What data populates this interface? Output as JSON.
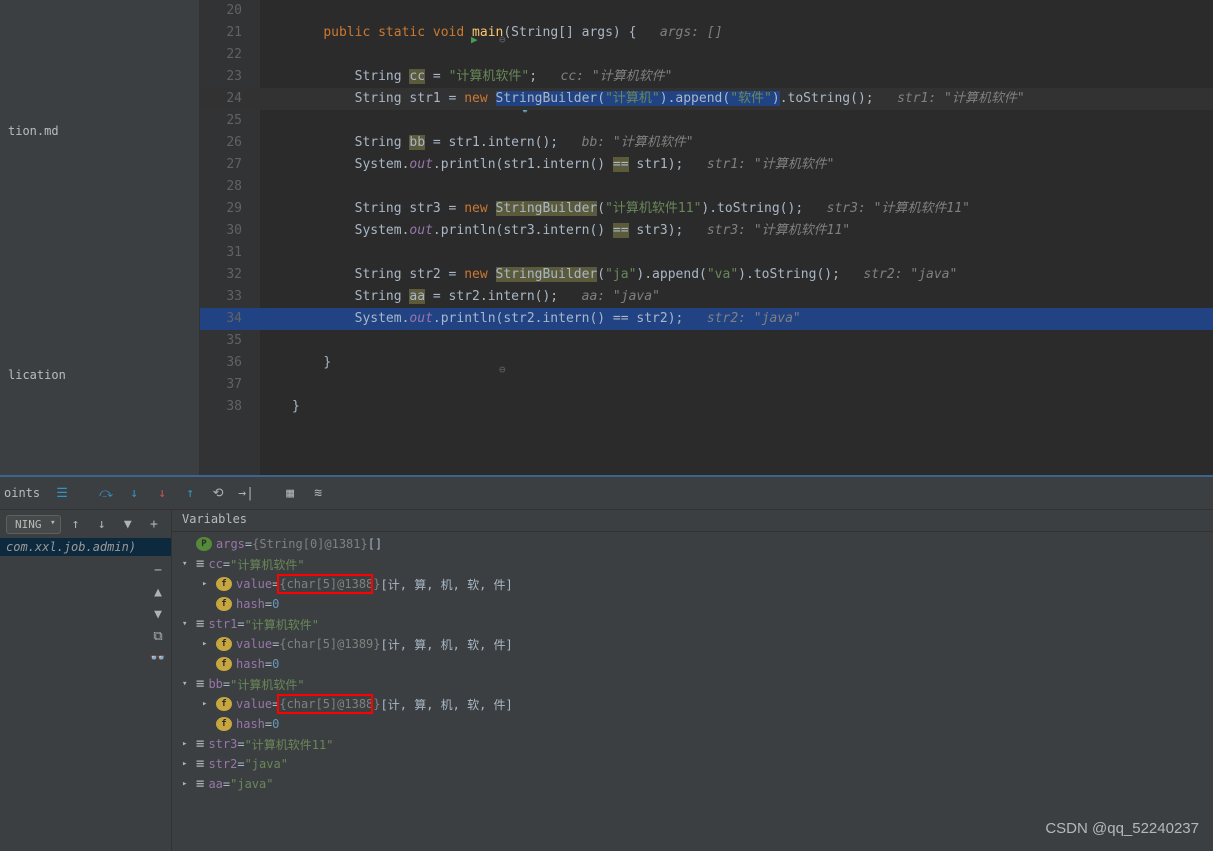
{
  "sidebar": {
    "item1": "tion.md",
    "item2": "lication"
  },
  "gutter": {
    "start": 20,
    "end": 38
  },
  "code": {
    "lines": [
      {
        "indent": 1,
        "tokens": []
      },
      {
        "indent": 1,
        "tokens": [
          {
            "t": "kw",
            "v": "public"
          },
          {
            "t": "sp"
          },
          {
            "t": "kw",
            "v": "static"
          },
          {
            "t": "sp"
          },
          {
            "t": "kw",
            "v": "void"
          },
          {
            "t": "sp"
          },
          {
            "t": "method",
            "v": "main"
          },
          {
            "t": "p",
            "v": "(String[] args) {"
          },
          {
            "t": "sp3"
          },
          {
            "t": "comment",
            "v": "args: []"
          }
        ]
      },
      {
        "indent": 1,
        "tokens": []
      },
      {
        "indent": 2,
        "tokens": [
          {
            "t": "p",
            "v": "String "
          },
          {
            "t": "hl",
            "v": "cc"
          },
          {
            "t": "p",
            "v": " = "
          },
          {
            "t": "str",
            "v": "\"计算机软件\""
          },
          {
            "t": "p",
            "v": ";"
          },
          {
            "t": "sp3"
          },
          {
            "t": "comment",
            "v": "cc: \"计算机软件\""
          }
        ]
      },
      {
        "indent": 2,
        "hl": "sel",
        "tokens": [
          {
            "t": "p",
            "v": "String str1 = "
          },
          {
            "t": "kw",
            "v": "new"
          },
          {
            "t": "sp"
          },
          {
            "t": "selbg",
            "v": "StringBuilder("
          },
          {
            "t": "selbg-str",
            "v": "\"计算机\""
          },
          {
            "t": "selbg",
            "v": ").append("
          },
          {
            "t": "selbg-str",
            "v": "\"软件\""
          },
          {
            "t": "selbg",
            "v": ")"
          },
          {
            "t": "p",
            "v": ".toString();"
          },
          {
            "t": "sp3"
          },
          {
            "t": "comment",
            "v": "str1: \"计算机软件\""
          }
        ]
      },
      {
        "indent": 2,
        "tokens": []
      },
      {
        "indent": 2,
        "tokens": [
          {
            "t": "p",
            "v": "String "
          },
          {
            "t": "hl",
            "v": "bb"
          },
          {
            "t": "p",
            "v": " = str1.intern();"
          },
          {
            "t": "sp3"
          },
          {
            "t": "comment",
            "v": "bb: \"计算机软件\""
          }
        ]
      },
      {
        "indent": 2,
        "tokens": [
          {
            "t": "p",
            "v": "System."
          },
          {
            "t": "field",
            "v": "out"
          },
          {
            "t": "p",
            "v": ".println(str1.intern() "
          },
          {
            "t": "hl",
            "v": "=="
          },
          {
            "t": "p",
            "v": " str1);"
          },
          {
            "t": "sp3"
          },
          {
            "t": "comment",
            "v": "str1: \"计算机软件\""
          }
        ]
      },
      {
        "indent": 2,
        "tokens": []
      },
      {
        "indent": 2,
        "tokens": [
          {
            "t": "p",
            "v": "String str3 = "
          },
          {
            "t": "kw",
            "v": "new"
          },
          {
            "t": "sp"
          },
          {
            "t": "hl",
            "v": "StringBuilder"
          },
          {
            "t": "p",
            "v": "("
          },
          {
            "t": "str",
            "v": "\"计算机软件11\""
          },
          {
            "t": "p",
            "v": ").toString();"
          },
          {
            "t": "sp3"
          },
          {
            "t": "comment",
            "v": "str3: \"计算机软件11\""
          }
        ]
      },
      {
        "indent": 2,
        "tokens": [
          {
            "t": "p",
            "v": "System."
          },
          {
            "t": "field",
            "v": "out"
          },
          {
            "t": "p",
            "v": ".println(str3.intern() "
          },
          {
            "t": "hl",
            "v": "=="
          },
          {
            "t": "p",
            "v": " str3);"
          },
          {
            "t": "sp3"
          },
          {
            "t": "comment",
            "v": "str3: \"计算机软件11\""
          }
        ]
      },
      {
        "indent": 2,
        "tokens": []
      },
      {
        "indent": 2,
        "tokens": [
          {
            "t": "p",
            "v": "String str2 = "
          },
          {
            "t": "kw",
            "v": "new"
          },
          {
            "t": "sp"
          },
          {
            "t": "hl",
            "v": "StringBuilder"
          },
          {
            "t": "p",
            "v": "("
          },
          {
            "t": "str",
            "v": "\"ja\""
          },
          {
            "t": "p",
            "v": ").append("
          },
          {
            "t": "str",
            "v": "\"va\""
          },
          {
            "t": "p",
            "v": ").toString();"
          },
          {
            "t": "sp3"
          },
          {
            "t": "comment",
            "v": "str2: \"java\""
          }
        ]
      },
      {
        "indent": 2,
        "tokens": [
          {
            "t": "p",
            "v": "String "
          },
          {
            "t": "hl",
            "v": "aa"
          },
          {
            "t": "p",
            "v": " = str2.intern();"
          },
          {
            "t": "sp3"
          },
          {
            "t": "comment",
            "v": "aa: \"java\""
          }
        ]
      },
      {
        "indent": 2,
        "hl": "line",
        "tokens": [
          {
            "t": "p",
            "v": "System."
          },
          {
            "t": "field",
            "v": "out"
          },
          {
            "t": "p",
            "v": ".println(str2.intern() == str2);"
          },
          {
            "t": "sp3"
          },
          {
            "t": "comment",
            "v": "str2: \"java\""
          }
        ]
      },
      {
        "indent": 2,
        "tokens": []
      },
      {
        "indent": 1,
        "tokens": [
          {
            "t": "p",
            "v": "}"
          }
        ]
      },
      {
        "indent": 0,
        "tokens": []
      },
      {
        "indent": 0,
        "tokens": [
          {
            "t": "p",
            "v": "}"
          }
        ]
      }
    ]
  },
  "debug": {
    "tab_label": "oints",
    "dropdown": "NING",
    "frame": "com.xxl.job.admin)",
    "vars_header": "Variables",
    "tree": [
      {
        "depth": 0,
        "arrow": "",
        "icon": "p",
        "name": "args",
        "eq": " = ",
        "type": "{String[0]@1381} ",
        "val": "[]"
      },
      {
        "depth": 0,
        "arrow": "v",
        "icon": "eq",
        "name": "cc",
        "eq": " = ",
        "str": "\"计算机软件\""
      },
      {
        "depth": 1,
        "arrow": ">",
        "icon": "f",
        "name": "value",
        "eq": " = ",
        "type": "{char[5]@1388} ",
        "val": "[计, 算, 机, 软, 件]",
        "redbox": true
      },
      {
        "depth": 1,
        "arrow": "",
        "icon": "f",
        "name": "hash",
        "eq": " = ",
        "num": "0"
      },
      {
        "depth": 0,
        "arrow": "v",
        "icon": "eq",
        "name": "str1",
        "eq": " = ",
        "str": "\"计算机软件\""
      },
      {
        "depth": 1,
        "arrow": ">",
        "icon": "f",
        "name": "value",
        "eq": " = ",
        "type": "{char[5]@1389} ",
        "val": "[计, 算, 机, 软, 件]"
      },
      {
        "depth": 1,
        "arrow": "",
        "icon": "f",
        "name": "hash",
        "eq": " = ",
        "num": "0"
      },
      {
        "depth": 0,
        "arrow": "v",
        "icon": "eq",
        "name": "bb",
        "eq": " = ",
        "str": "\"计算机软件\""
      },
      {
        "depth": 1,
        "arrow": ">",
        "icon": "f",
        "name": "value",
        "eq": " = ",
        "type": "{char[5]@1388} ",
        "val": "[计, 算, 机, 软, 件]",
        "redbox": true
      },
      {
        "depth": 1,
        "arrow": "",
        "icon": "f",
        "name": "hash",
        "eq": " = ",
        "num": "0"
      },
      {
        "depth": 0,
        "arrow": ">",
        "icon": "eq",
        "name": "str3",
        "eq": " = ",
        "str": "\"计算机软件11\""
      },
      {
        "depth": 0,
        "arrow": ">",
        "icon": "eq",
        "name": "str2",
        "eq": " = ",
        "str": "\"java\""
      },
      {
        "depth": 0,
        "arrow": ">",
        "icon": "eq",
        "name": "aa",
        "eq": " = ",
        "str": "\"java\""
      }
    ]
  },
  "watermark": "CSDN @qq_52240237"
}
